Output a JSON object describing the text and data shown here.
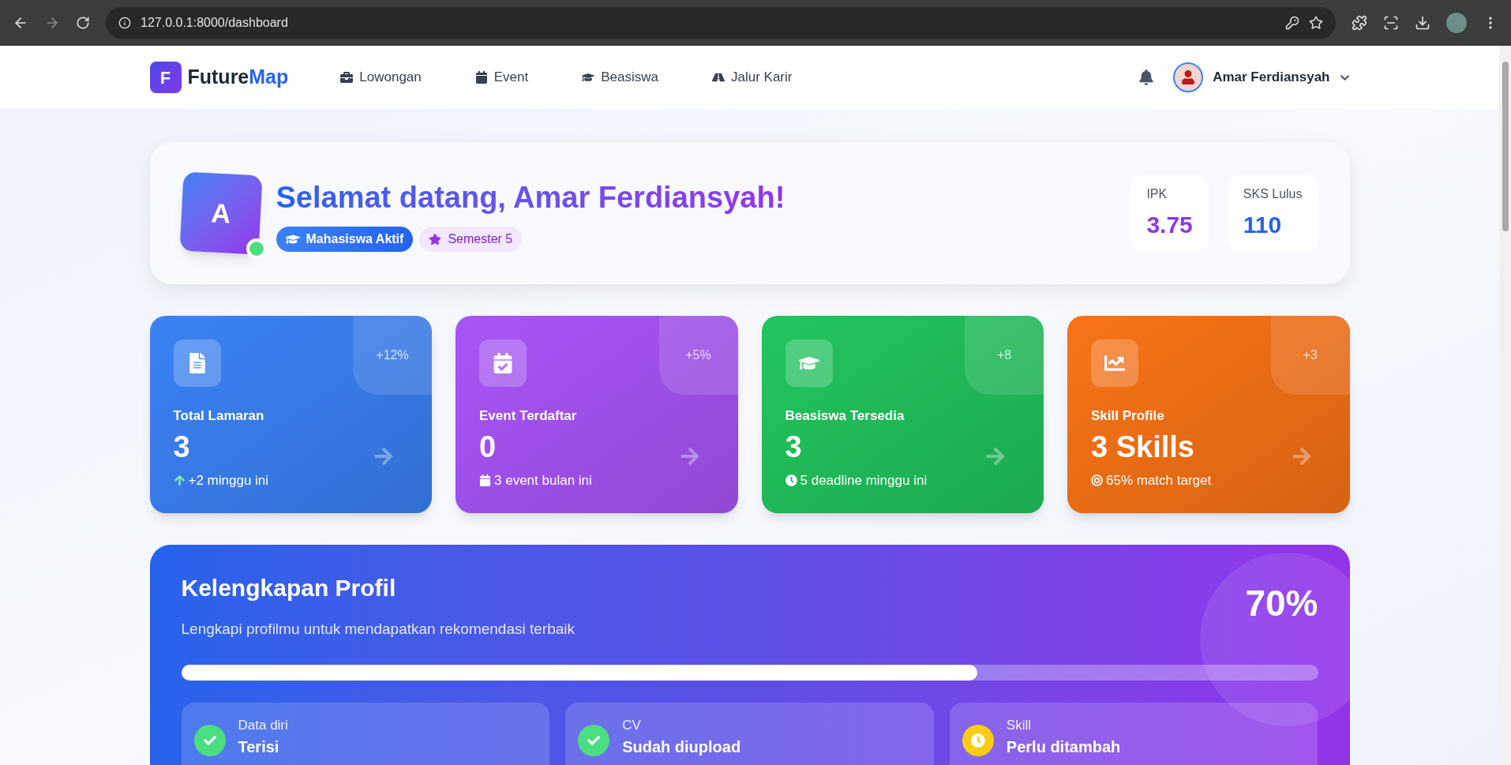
{
  "browser": {
    "url": "127.0.0.1:8000/dashboard"
  },
  "nav": {
    "logo_letter": "F",
    "brand_main": "Future",
    "brand_accent": "Map",
    "links": [
      "Lowongan",
      "Event",
      "Beasiswa",
      "Jalur Karir"
    ],
    "user_name": "Amar Ferdiansyah"
  },
  "welcome": {
    "avatar_letter": "A",
    "online": true,
    "greeting": "Selamat datang, Amar Ferdiansyah!",
    "badges": [
      "Mahasiswa Aktif",
      "Semester 5"
    ],
    "stats": [
      {
        "label": "IPK",
        "value": "3.75",
        "color": "#9333ea"
      },
      {
        "label": "SKS Lulus",
        "value": "110",
        "color": "#2563eb"
      }
    ]
  },
  "stat_cards": [
    {
      "title": "Total Lamaran",
      "value": "3",
      "change": "+12%",
      "note": "+2 minggu ini",
      "color": "#3b82f6"
    },
    {
      "title": "Event Terdaftar",
      "value": "0",
      "change": "+5%",
      "note": "3 event bulan ini",
      "color": "#a855f7"
    },
    {
      "title": "Beasiswa Tersedia",
      "value": "3",
      "change": "+8",
      "note": "5 deadline minggu ini",
      "color": "#22c55e"
    },
    {
      "title": "Skill Profile",
      "value": "3 Skills",
      "change": "+3",
      "note": "65% match target",
      "color": "#f97316"
    }
  ],
  "profile": {
    "title": "Kelengkapan Profil",
    "subtitle": "Lengkapi profilmu untuk mendapatkan rekomendasi terbaik",
    "percent": "70%",
    "level": 0.7,
    "items": [
      {
        "label": "Data diri",
        "status": "Terisi",
        "done": true
      },
      {
        "label": "CV",
        "status": "Sudah diupload",
        "done": true
      },
      {
        "label": "Skill",
        "status": "Perlu ditambah",
        "done": false
      }
    ]
  }
}
